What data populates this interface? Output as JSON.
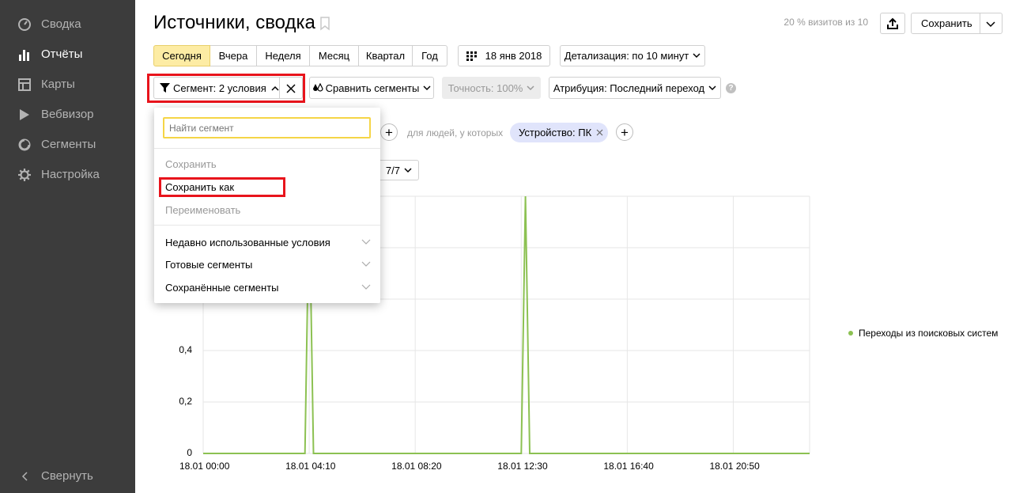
{
  "sidebar": {
    "items": [
      {
        "label": "Сводка",
        "icon": "dashboard-icon"
      },
      {
        "label": "Отчёты",
        "icon": "reports-icon",
        "active": true
      },
      {
        "label": "Карты",
        "icon": "maps-icon"
      },
      {
        "label": "Вебвизор",
        "icon": "play-icon"
      },
      {
        "label": "Сегменты",
        "icon": "segments-icon"
      },
      {
        "label": "Настройка",
        "icon": "gear-icon"
      }
    ],
    "collapse_label": "Свернуть"
  },
  "header": {
    "title": "Источники, сводка",
    "visits_note": "20 % визитов из 10",
    "save_label": "Сохранить"
  },
  "periods": [
    "Сегодня",
    "Вчера",
    "Неделя",
    "Месяц",
    "Квартал",
    "Год"
  ],
  "selected_period": "Сегодня",
  "date_label": "18 янв 2018",
  "detail_label": "Детализация: по 10 минут",
  "segment_label": "Сегмент: 2 условия",
  "compare_label": "Сравнить сегменты",
  "accuracy_label": "Точность: 100%",
  "attribution_label": "Атрибуция: Последний переход",
  "condition_text": "для людей, у которых",
  "device_chip": "Устройство: ПК",
  "metrics_counter": "7/7",
  "dropdown": {
    "search_placeholder": "Найти сегмент",
    "save": "Сохранить",
    "save_as": "Сохранить как",
    "rename": "Переименовать",
    "recent": "Недавно использованные условия",
    "ready": "Готовые сегменты",
    "saved": "Сохранённые сегменты"
  },
  "colors": {
    "sidebar_bg": "#3c3c3c",
    "selected_period_bg": "#fdeca4",
    "highlight_red": "#e8141c",
    "series_green": "#8cc152",
    "chip_bg": "#e0e4fb"
  },
  "chart_data": {
    "type": "line",
    "x": [
      "18.01 00:00",
      "18.01 04:10",
      "18.01 08:20",
      "18.01 12:30",
      "18.01 16:40",
      "18.01 20:50"
    ],
    "y_ticks": [
      "0",
      "0,2",
      "0,4"
    ],
    "ylim": [
      0,
      1
    ],
    "series": [
      {
        "name": "Переходы из поисковых систем",
        "points": [
          [
            "18.01 00:00",
            0
          ],
          [
            "18.01 04:00",
            0
          ],
          [
            "18.01 04:10",
            1
          ],
          [
            "18.01 04:20",
            0
          ],
          [
            "18.01 12:30",
            0
          ],
          [
            "18.01 12:40",
            1
          ],
          [
            "18.01 12:50",
            0
          ],
          [
            "18.01 23:50",
            0
          ]
        ]
      }
    ],
    "legend_position": "right",
    "grid": true
  }
}
